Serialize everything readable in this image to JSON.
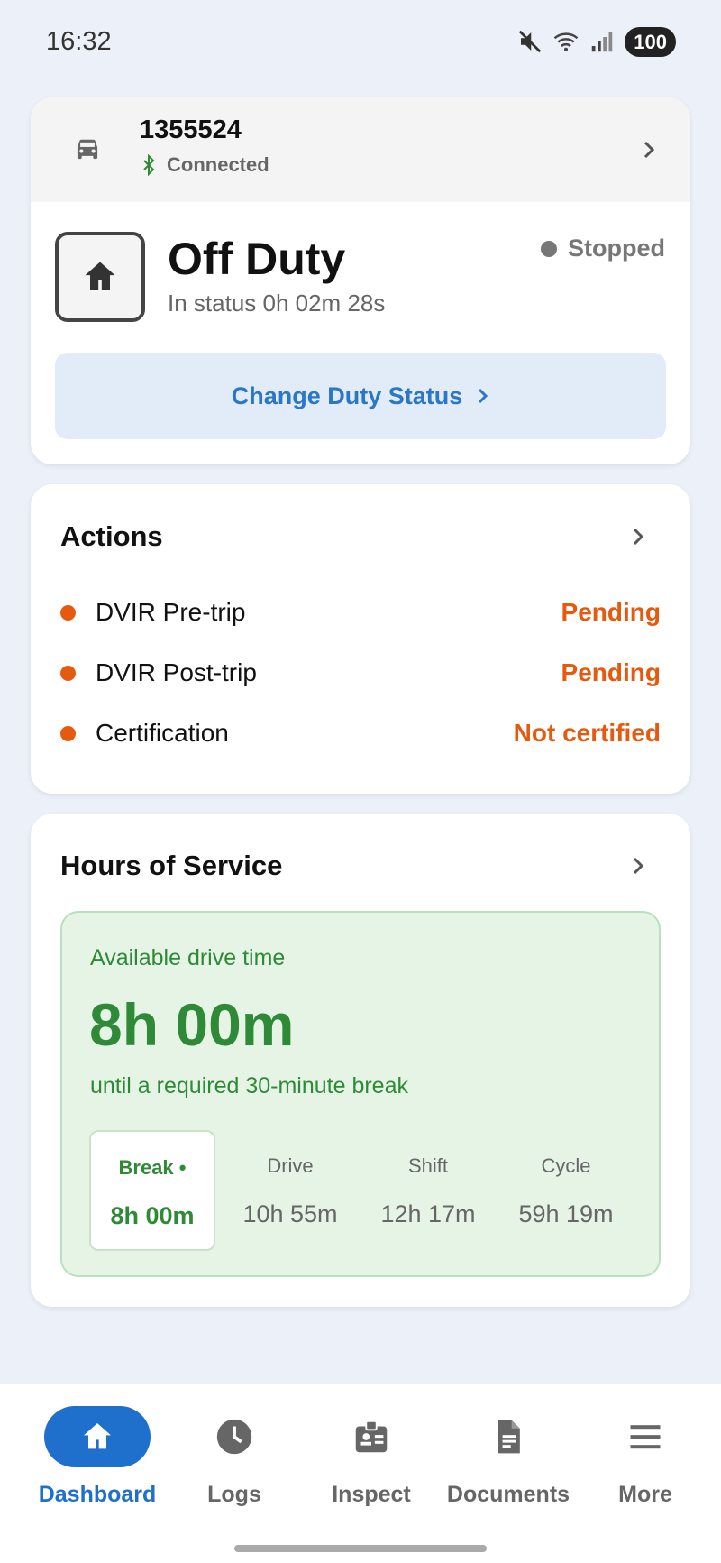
{
  "status_bar": {
    "time": "16:32",
    "battery": "100"
  },
  "vehicle": {
    "id": "1355524",
    "connection": "Connected"
  },
  "duty": {
    "title": "Off Duty",
    "in_status": "In status 0h 02m 28s",
    "motion": "Stopped",
    "change_button": "Change Duty Status"
  },
  "actions": {
    "title": "Actions",
    "items": [
      {
        "label": "DVIR Pre-trip",
        "status": "Pending"
      },
      {
        "label": "DVIR Post-trip",
        "status": "Pending"
      },
      {
        "label": "Certification",
        "status": "Not certified"
      }
    ]
  },
  "hos": {
    "title": "Hours of Service",
    "available_label": "Available drive time",
    "available_value": "8h 00m",
    "until": "until a required 30-minute break",
    "clocks": [
      {
        "label": "Break •",
        "value": "8h 00m"
      },
      {
        "label": "Drive",
        "value": "10h 55m"
      },
      {
        "label": "Shift",
        "value": "12h 17m"
      },
      {
        "label": "Cycle",
        "value": "59h 19m"
      }
    ]
  },
  "nav": {
    "items": [
      {
        "label": "Dashboard",
        "icon": "home-icon"
      },
      {
        "label": "Logs",
        "icon": "clock-icon"
      },
      {
        "label": "Inspect",
        "icon": "id-badge-icon"
      },
      {
        "label": "Documents",
        "icon": "document-icon"
      },
      {
        "label": "More",
        "icon": "menu-icon"
      }
    ]
  },
  "colors": {
    "accent": "#1f6fcc",
    "warning": "#e65a10",
    "ok": "#2e8a36",
    "background": "#ecf0f8"
  }
}
